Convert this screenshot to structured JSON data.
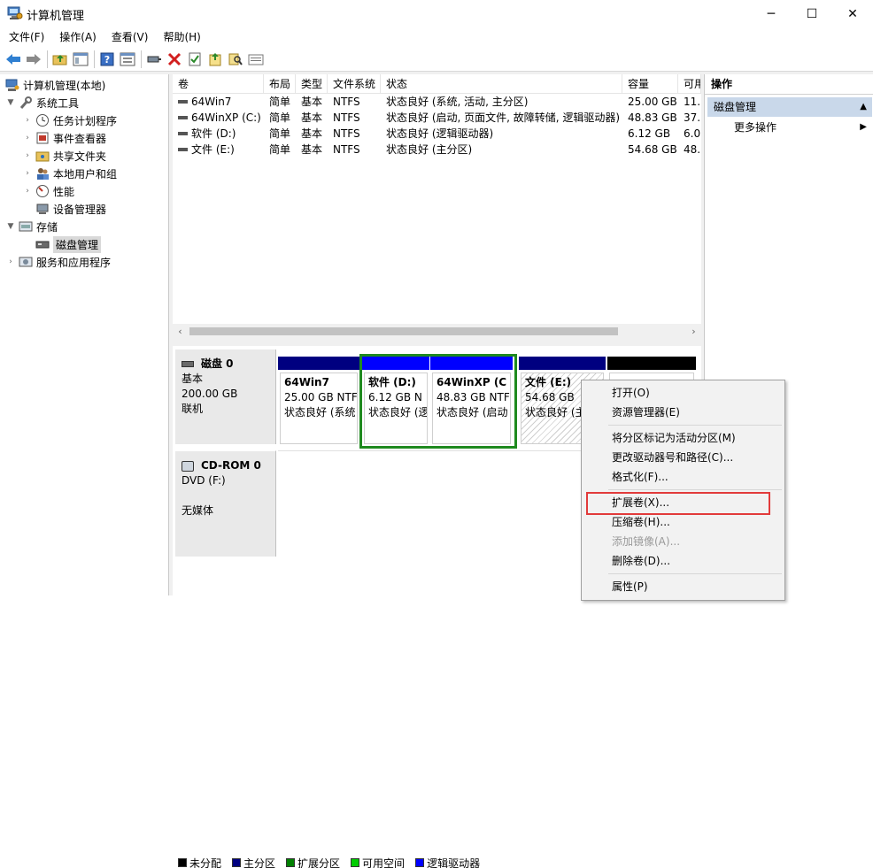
{
  "window": {
    "title": "计算机管理",
    "minimize": "─",
    "maximize": "☐",
    "close": "✕"
  },
  "menu": [
    "文件(F)",
    "操作(A)",
    "查看(V)",
    "帮助(H)"
  ],
  "toolbar_icons": [
    "back-icon",
    "forward-icon",
    "up-folder-icon",
    "show-tree-icon",
    "help-icon",
    "properties-icon",
    "connect-icon",
    "delete-icon",
    "check-icon",
    "wizard-icon",
    "search-icon",
    "list-view-icon"
  ],
  "tree": {
    "root": "计算机管理(本地)",
    "system_tools": "系统工具",
    "items": [
      "任务计划程序",
      "事件查看器",
      "共享文件夹",
      "本地用户和组",
      "性能",
      "设备管理器"
    ],
    "storage": "存储",
    "disk_mgmt": "磁盘管理",
    "services": "服务和应用程序"
  },
  "volume_list": {
    "columns": [
      "卷",
      "布局",
      "类型",
      "文件系统",
      "状态",
      "容量",
      "可用"
    ],
    "rows": [
      [
        "64Win7",
        "简单",
        "基本",
        "NTFS",
        "状态良好 (系统, 活动, 主分区)",
        "25.00 GB",
        "11."
      ],
      [
        "64WinXP  (C:)",
        "简单",
        "基本",
        "NTFS",
        "状态良好 (启动, 页面文件, 故障转储, 逻辑驱动器)",
        "48.83 GB",
        "37."
      ],
      [
        "软件 (D:)",
        "简单",
        "基本",
        "NTFS",
        "状态良好 (逻辑驱动器)",
        "6.12 GB",
        "6.0"
      ],
      [
        "文件 (E:)",
        "简单",
        "基本",
        "NTFS",
        "状态良好 (主分区)",
        "54.68 GB",
        "48."
      ]
    ]
  },
  "disk0": {
    "name": "磁盘 0",
    "type": "基本",
    "size": "200.00 GB",
    "status": "联机",
    "partitions": [
      {
        "name": "64Win7",
        "size": "25.00 GB NTF",
        "status": "状态良好 (系统",
        "bar": "#000080"
      },
      {
        "name": "软件  (D:)",
        "size": "6.12 GB N",
        "status": "状态良好 (逻",
        "bar": "#0000ff"
      },
      {
        "name": "64WinXP  (C",
        "size": "48.83 GB NTF",
        "status": "状态良好 (启动",
        "bar": "#0000ff"
      },
      {
        "name": "文件  (E:)",
        "size": "54.68 GB",
        "status": "状态良好 (主",
        "bar": "#000080"
      }
    ]
  },
  "cdrom0": {
    "name": "CD-ROM 0",
    "drive": "DVD (F:)",
    "media": "无媒体"
  },
  "legend": [
    {
      "label": "未分配",
      "color": "#000000"
    },
    {
      "label": "主分区",
      "color": "#000080"
    },
    {
      "label": "扩展分区",
      "color": "#008000"
    },
    {
      "label": "可用空间",
      "color": "#00cc00"
    },
    {
      "label": "逻辑驱动器",
      "color": "#0000ff"
    }
  ],
  "actions": {
    "header": "操作",
    "section": "磁盘管理",
    "more": "更多操作"
  },
  "context_menu": {
    "open": "打开(O)",
    "explorer": "资源管理器(E)",
    "mark_active": "将分区标记为活动分区(M)",
    "change_letter": "更改驱动器号和路径(C)...",
    "format": "格式化(F)...",
    "extend": "扩展卷(X)...",
    "shrink": "压缩卷(H)...",
    "mirror": "添加镜像(A)...",
    "delete": "删除卷(D)...",
    "properties": "属性(P)"
  }
}
